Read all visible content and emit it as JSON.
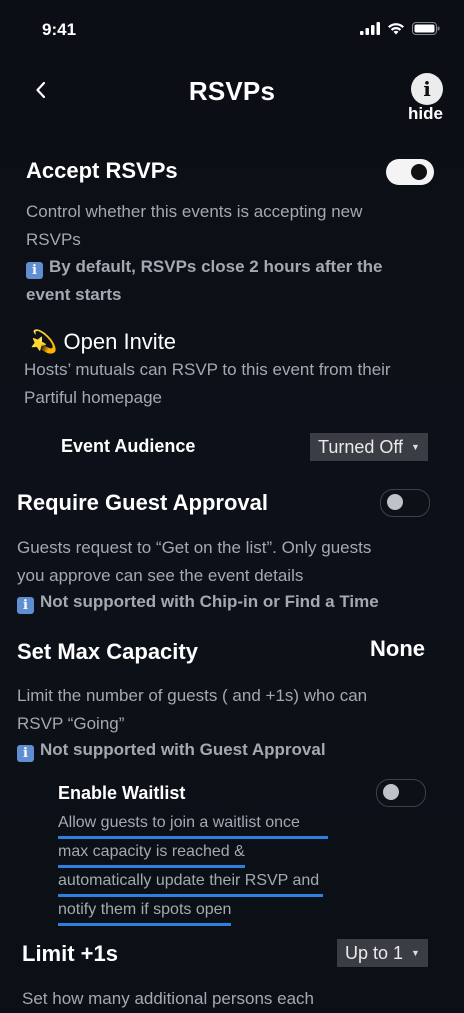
{
  "status": {
    "time": "9:41"
  },
  "header": {
    "title": "RSVPs",
    "info_glyph": "i",
    "hide_label": "hide"
  },
  "accept": {
    "title": "Accept RSVPs",
    "desc_line1": "Control whether this events is accepting new",
    "desc_line2": "RSVPs",
    "note_line1": "By default, RSVPs close 2 hours after the",
    "note_line2": "event starts",
    "toggle_on": true
  },
  "open_invite": {
    "emoji": "💫",
    "title": "Open Invite",
    "desc_line1": "Hosts’ mutuals can RSVP to this event from their",
    "desc_line2": "Partiful homepage",
    "audience_label": "Event Audience",
    "audience_value": "Turned Off"
  },
  "guest_approval": {
    "title": "Require Guest Approval",
    "desc_line1": "Guests request to “Get on the list”. Only guests",
    "desc_line2": "you approve can see the event details",
    "note": "Not supported with Chip-in or Find a Time",
    "toggle_on": false
  },
  "max_capacity": {
    "title": "Set Max Capacity",
    "value": "None",
    "desc_line1": "Limit the number of guests ( and +1s) who can",
    "desc_line2": "RSVP “Going”",
    "note": "Not supported with Guest Approval"
  },
  "waitlist": {
    "title": "Enable Waitlist",
    "line1": "Allow guests to join a waitlist once",
    "line2": "max capacity is reached &",
    "line3": "automatically update their RSVP and",
    "line4": "notify them if spots open",
    "toggle_on": false
  },
  "plus_ones": {
    "title": "Limit +1s",
    "value": "Up to 1",
    "desc_line1": "Set how many additional persons each"
  },
  "colors": {
    "accent_underline": "#2f7fe0",
    "info_box": "#5f8fd0"
  }
}
